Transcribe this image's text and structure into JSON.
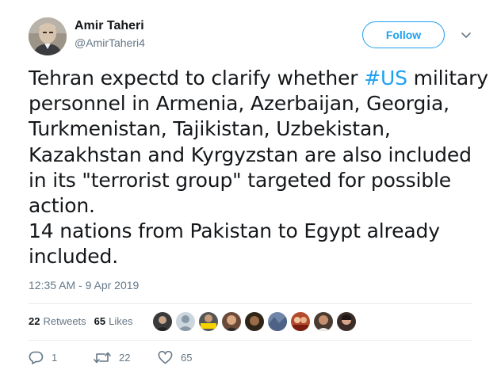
{
  "author": {
    "name": "Amir Taheri",
    "handle": "@AmirTaheri4"
  },
  "follow_label": "Follow",
  "tweet": {
    "lines": [
      {
        "before": "Tehran expectd to clarify whether ",
        "hashtag": "#US",
        "after": " military"
      },
      "personnel in Armenia, Azerbaijan, Georgia,",
      "Turkmenistan, Tajikistan, Uzbekistan,",
      "Kazakhstan and Kyrgyzstan are also included",
      "in its \"terrorist group\" targeted for possible",
      "action.",
      "14 nations from Pakistan to Egypt already",
      "included."
    ],
    "timestamp": "12:35 AM - 9 Apr 2019"
  },
  "stats": {
    "retweets_count": "22",
    "retweets_label": "Retweets",
    "likes_count": "65",
    "likes_label": "Likes"
  },
  "actions": {
    "reply_count": "1",
    "retweet_count": "22",
    "like_count": "65"
  },
  "colors": {
    "accent": "#1da1f2",
    "muted": "#657786",
    "text": "#14171a",
    "divider": "#e6ecf0"
  },
  "icons": [
    "reply-icon",
    "retweet-icon",
    "heart-icon",
    "chevron-down-icon"
  ]
}
